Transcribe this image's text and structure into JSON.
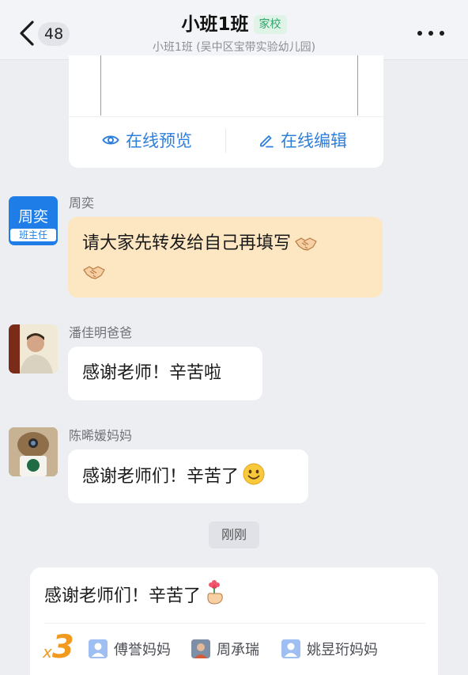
{
  "header": {
    "unread_count": "48",
    "title": "小班1班",
    "tag": "家校",
    "subtitle": "小班1班 (吴中区宝带实验幼儿园)"
  },
  "file_card": {
    "preview_action": "在线预览",
    "edit_action": "在线编辑"
  },
  "messages": [
    {
      "sender": "周奕",
      "avatar_name": "周奕",
      "avatar_role": "班主任",
      "text": "请大家先转发给自己再填写",
      "emoji": "handshake",
      "style": "highlight"
    },
    {
      "sender": "潘佳明爸爸",
      "text": "感谢老师！辛苦啦"
    },
    {
      "sender": "陈晞媛妈妈",
      "text": "感谢老师们！辛苦了",
      "emoji": "smiling-face"
    }
  ],
  "time_divider": "刚刚",
  "reaction_card": {
    "text": "感谢老师们！辛苦了",
    "emoji": "hand-holding-flower",
    "count_prefix": "x",
    "count": "3",
    "reactors": [
      "傅誉妈妈",
      "周承瑞",
      "姚昱珩妈妈"
    ]
  },
  "colors": {
    "accent_blue": "#2e7fdc",
    "teacher_blue": "#1f7de8",
    "tag_green": "#2ea66a",
    "highlight_bubble": "#fde7c3",
    "reaction_orange": "#f29a1f"
  }
}
